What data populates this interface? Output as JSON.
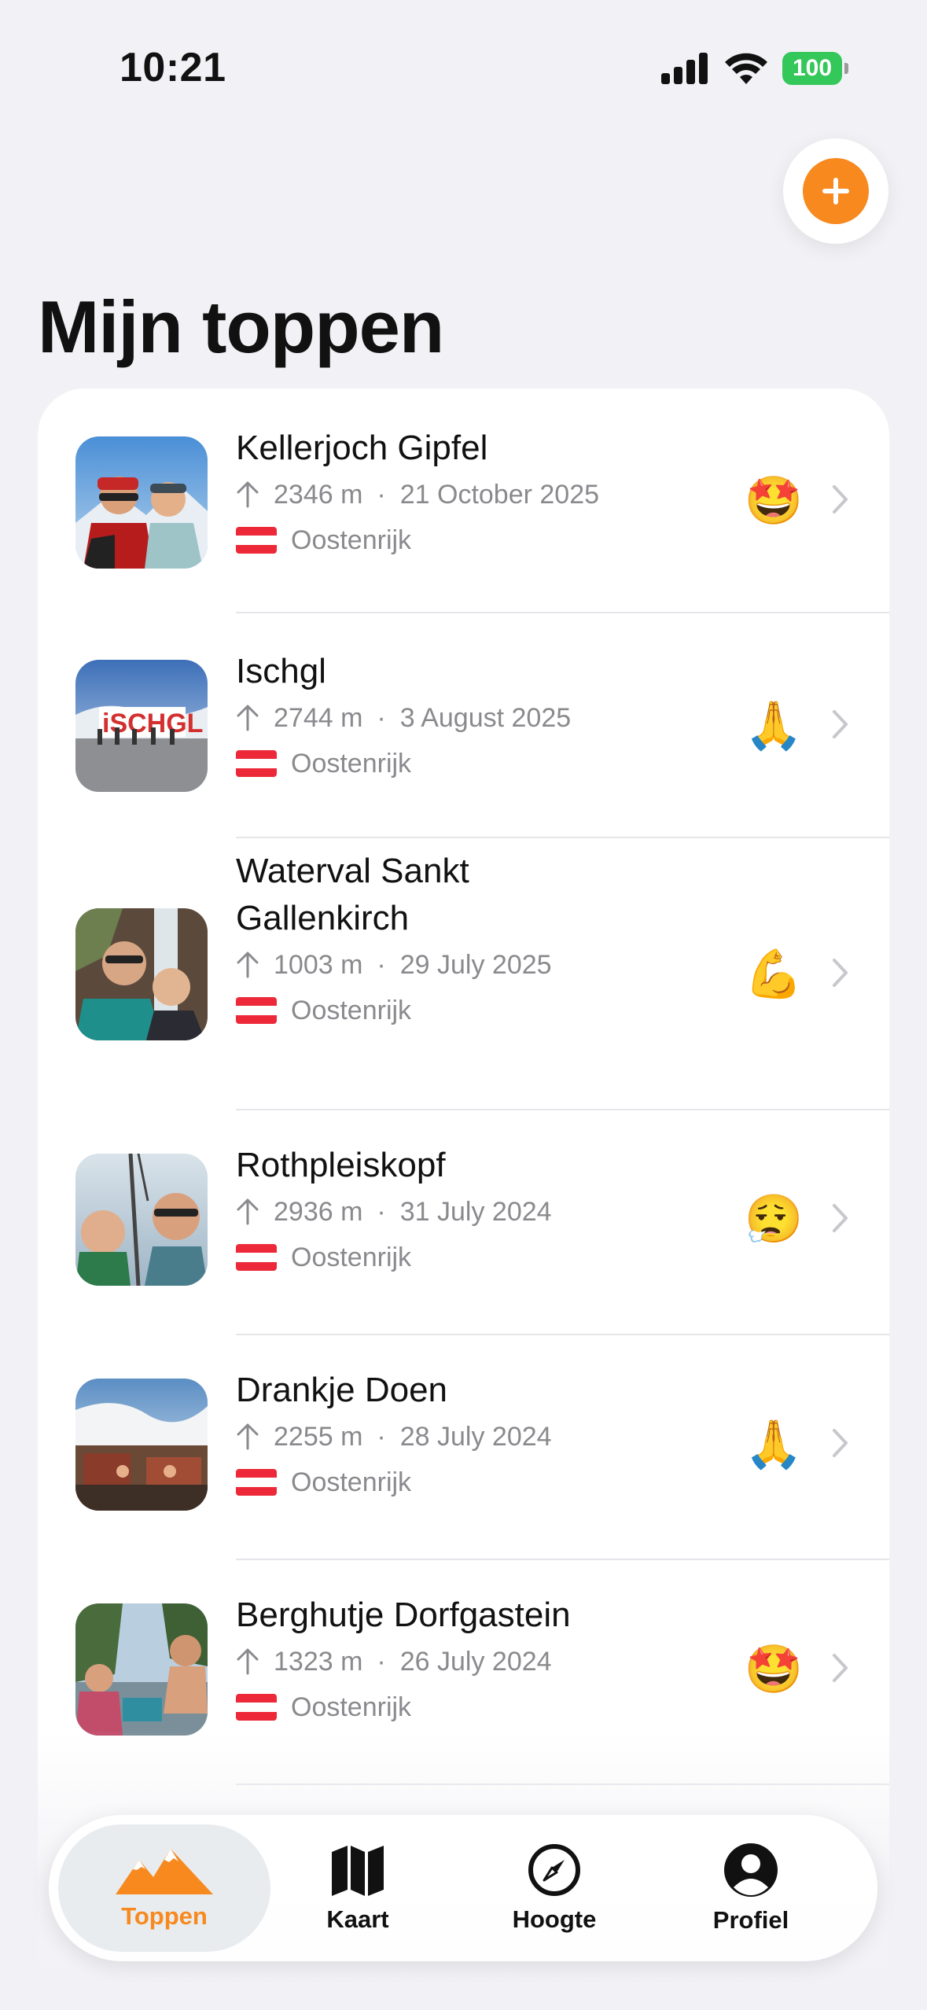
{
  "status_bar": {
    "time": "10:21",
    "battery": "100"
  },
  "page": {
    "title": "Mijn toppen"
  },
  "colors": {
    "accent": "#f7891f",
    "battery": "#34c759"
  },
  "summits": [
    {
      "name": "Kellerjoch Gipfel",
      "elevation": "2346 m",
      "date": "21 October 2025",
      "country": "Oostenrijk",
      "emoji": "🤩"
    },
    {
      "name": "Ischgl",
      "elevation": "2744 m",
      "date": "3 August 2025",
      "country": "Oostenrijk",
      "emoji": "🙏"
    },
    {
      "name": "Waterval Sankt Gallenkirch",
      "elevation": "1003 m",
      "date": "29 July 2025",
      "country": "Oostenrijk",
      "emoji": "💪"
    },
    {
      "name": "Rothpleiskopf",
      "elevation": "2936 m",
      "date": "31 July 2024",
      "country": "Oostenrijk",
      "emoji": "😮‍💨"
    },
    {
      "name": "Drankje Doen",
      "elevation": "2255 m",
      "date": "28 July 2024",
      "country": "Oostenrijk",
      "emoji": "🙏"
    },
    {
      "name": "Berghutje Dorfgastein",
      "elevation": "1323 m",
      "date": "26 July 2024",
      "country": "Oostenrijk",
      "emoji": "🤩"
    }
  ],
  "tabs": [
    {
      "label": "Toppen",
      "icon": "mountains-icon"
    },
    {
      "label": "Kaart",
      "icon": "map-icon"
    },
    {
      "label": "Hoogte",
      "icon": "compass-icon"
    },
    {
      "label": "Profiel",
      "icon": "profile-icon"
    }
  ]
}
